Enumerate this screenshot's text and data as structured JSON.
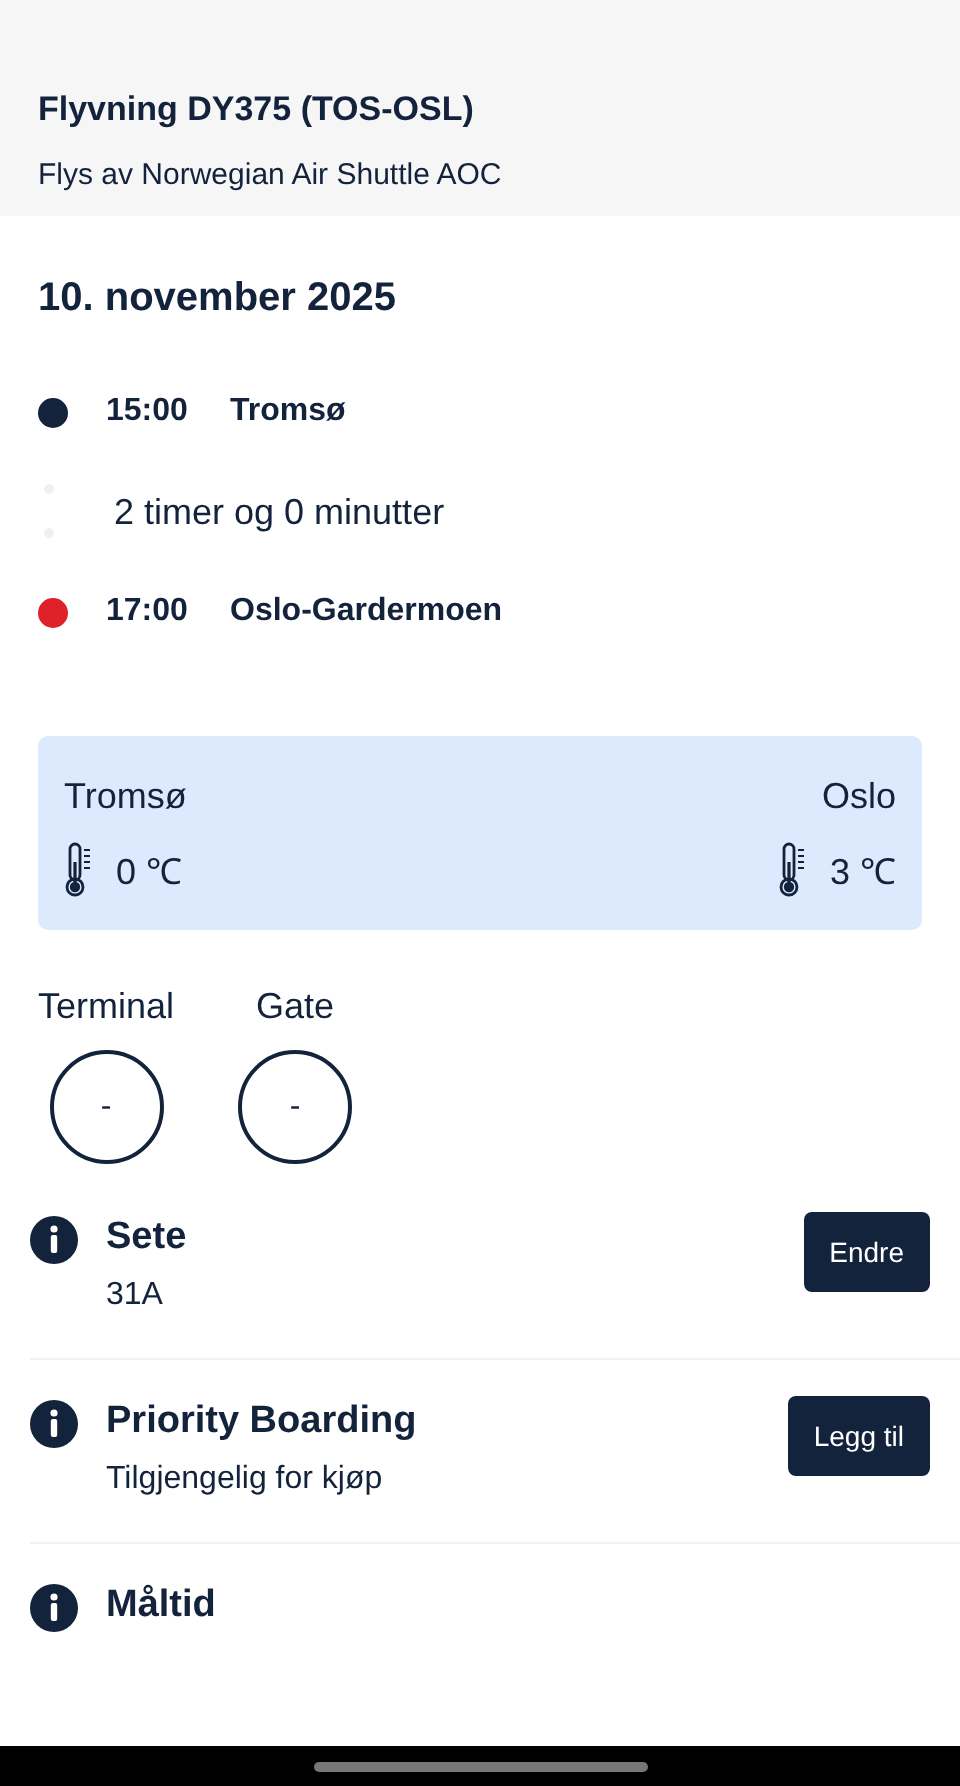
{
  "header": {
    "title": "Flyvning DY375 (TOS-OSL)",
    "subtitle": "Flys av Norwegian Air Shuttle AOC"
  },
  "date": "10. november 2025",
  "itinerary": [
    {
      "kind": "stop",
      "time": "15:00",
      "place": "Tromsø",
      "color": "#14233c"
    },
    {
      "kind": "duration",
      "text": "2 timer og 0 minutter"
    },
    {
      "kind": "stop",
      "time": "17:00",
      "place": "Oslo-Gardermoen",
      "color": "#e0202a"
    }
  ],
  "weather": [
    {
      "city": "Tromsø",
      "temp": "0 ℃"
    },
    {
      "city": "Oslo",
      "temp": "3 ℃"
    }
  ],
  "info": [
    {
      "label": "Terminal",
      "value": "-"
    },
    {
      "label": "Gate",
      "value": "-"
    }
  ],
  "services": [
    {
      "title": "Sete",
      "detail": "31A",
      "button": "Endre"
    },
    {
      "title": "Priority Boarding",
      "detail": "Tilgjengelig for kjøp",
      "button": "Legg til"
    },
    {
      "title": "Måltid"
    }
  ]
}
